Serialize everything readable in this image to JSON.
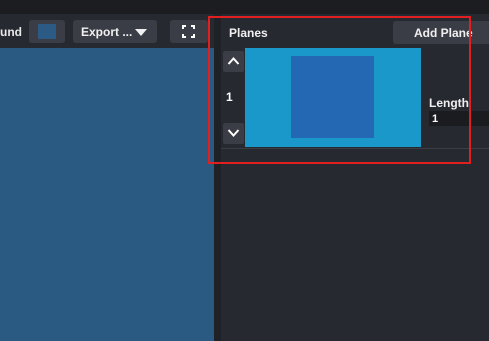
{
  "toolbar": {
    "background_label": "und",
    "background_color": "#2b5b85",
    "export_label": "Export ...",
    "export_icon": "chevron-down-icon",
    "fullscreen_icon": "fullscreen-icon"
  },
  "canvas": {
    "color": "#2a5a82"
  },
  "planes_panel": {
    "title": "Planes",
    "add_label": "Add Plane",
    "planes": [
      {
        "index": "1",
        "length_label": "Length",
        "length_value": "1",
        "up_icon": "chevron-up-icon",
        "down_icon": "chevron-down-icon"
      }
    ]
  },
  "highlight": {
    "color": "#e02020"
  }
}
